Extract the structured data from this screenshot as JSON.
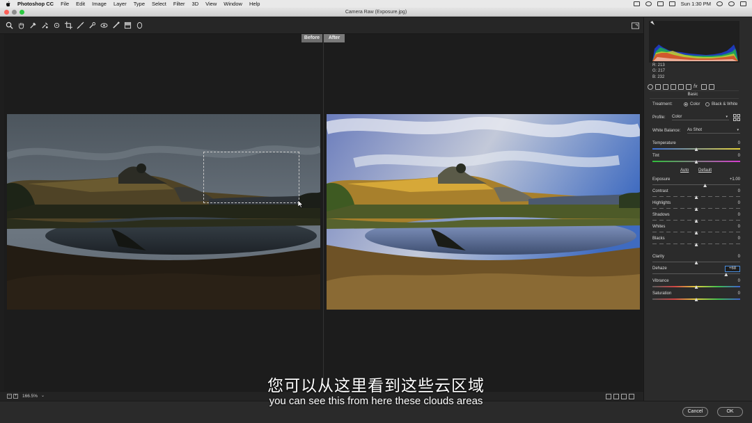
{
  "menubar": {
    "app": "Photoshop CC",
    "items": [
      "File",
      "Edit",
      "Image",
      "Layer",
      "Type",
      "Select",
      "Filter",
      "3D",
      "View",
      "Window",
      "Help"
    ],
    "clock": "Sun 1:30 PM"
  },
  "window": {
    "title": "Camera Raw (Exposure.jpg)"
  },
  "toolbar": {
    "tools": [
      "zoom-tool-icon",
      "hand-tool-icon",
      "white-balance-tool-icon",
      "color-sampler-icon",
      "targeted-adjustment-icon",
      "crop-tool-icon",
      "straighten-tool-icon",
      "spot-removal-icon",
      "red-eye-icon",
      "adjustment-brush-icon",
      "graduated-filter-icon",
      "radial-filter-icon"
    ]
  },
  "preview": {
    "before_label": "Before",
    "after_label": "After"
  },
  "statusbar": {
    "zoom": "166.5%"
  },
  "histogram": {
    "r": "R: 213",
    "g": "G: 217",
    "b": "B: 232"
  },
  "panel": {
    "title": "Basic",
    "treatment": {
      "label": "Treatment:",
      "color": "Color",
      "bw": "Black & White",
      "selected": "Color"
    },
    "profile": {
      "label": "Profile:",
      "value": "Color"
    },
    "white_balance": {
      "label": "White Balance:",
      "value": "As Shot"
    },
    "auto": "Auto",
    "default": "Default",
    "sliders": [
      {
        "label": "Temperature",
        "value": "0",
        "pos": 0.5
      },
      {
        "label": "Tint",
        "value": "0",
        "pos": 0.5
      },
      {
        "label": "Exposure",
        "value": "+1.00",
        "pos": 0.6
      },
      {
        "label": "Contrast",
        "value": "0",
        "pos": 0.5
      },
      {
        "label": "Highlights",
        "value": "0",
        "pos": 0.5
      },
      {
        "label": "Shadows",
        "value": "0",
        "pos": 0.5
      },
      {
        "label": "Whites",
        "value": "0",
        "pos": 0.5
      },
      {
        "label": "Blacks",
        "value": "0",
        "pos": 0.5
      },
      {
        "label": "Clarity",
        "value": "0",
        "pos": 0.5
      },
      {
        "label": "Dehaze",
        "value": "+68",
        "pos": 0.84
      },
      {
        "label": "Vibrance",
        "value": "0",
        "pos": 0.5
      },
      {
        "label": "Saturation",
        "value": "0",
        "pos": 0.5
      }
    ]
  },
  "buttons": {
    "cancel": "Cancel",
    "ok": "OK"
  },
  "subtitles": {
    "cn": "您可以从这里看到这些云区域",
    "en": "you can see this from here these clouds areas"
  },
  "colors": {
    "accent": "#4a8fe0"
  }
}
